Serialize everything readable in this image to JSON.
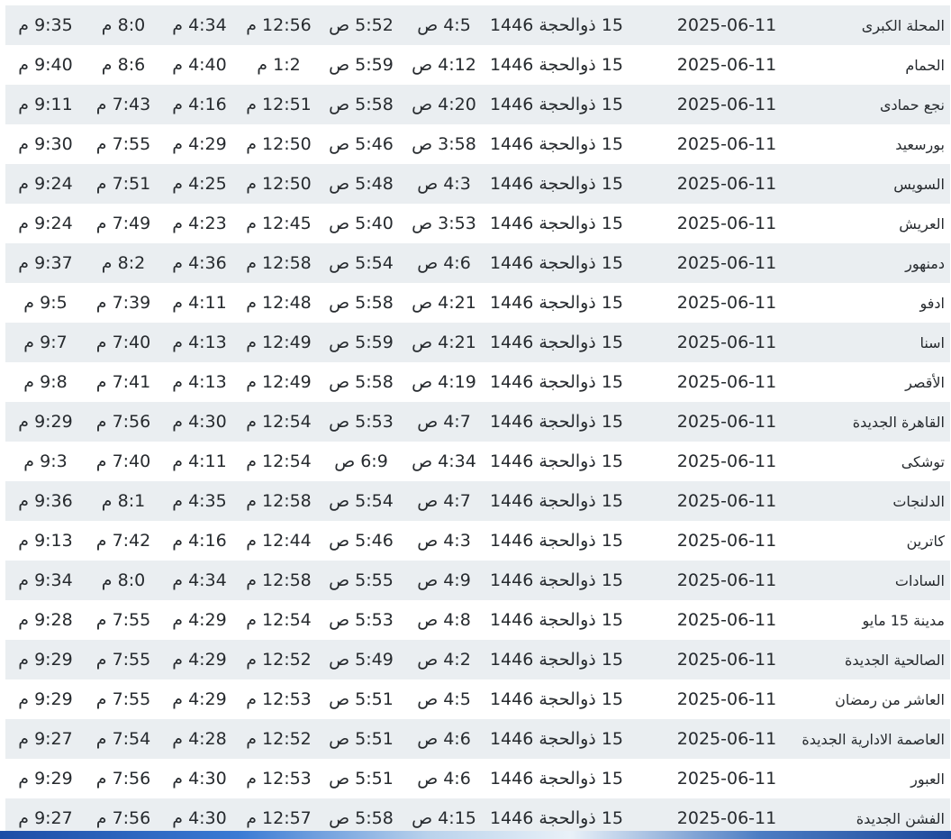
{
  "prayer_table": {
    "rows": [
      {
        "city": "المحلة الكبرى",
        "gregorian": "2025-06-11",
        "hijri": "15 ذوالحجة 1446",
        "fajr": "4:5 ص",
        "sunrise": "5:52 ص",
        "dhuhr": "12:56 م",
        "asr": "4:34 م",
        "maghrib": "8:0 م",
        "isha": "9:35 م"
      },
      {
        "city": "الحمام",
        "gregorian": "2025-06-11",
        "hijri": "15 ذوالحجة 1446",
        "fajr": "4:12 ص",
        "sunrise": "5:59 ص",
        "dhuhr": "1:2 م",
        "asr": "4:40 م",
        "maghrib": "8:6 م",
        "isha": "9:40 م"
      },
      {
        "city": "نجع حمادى",
        "gregorian": "2025-06-11",
        "hijri": "15 ذوالحجة 1446",
        "fajr": "4:20 ص",
        "sunrise": "5:58 ص",
        "dhuhr": "12:51 م",
        "asr": "4:16 م",
        "maghrib": "7:43 م",
        "isha": "9:11 م"
      },
      {
        "city": "بورسعيد",
        "gregorian": "2025-06-11",
        "hijri": "15 ذوالحجة 1446",
        "fajr": "3:58 ص",
        "sunrise": "5:46 ص",
        "dhuhr": "12:50 م",
        "asr": "4:29 م",
        "maghrib": "7:55 م",
        "isha": "9:30 م"
      },
      {
        "city": "السويس",
        "gregorian": "2025-06-11",
        "hijri": "15 ذوالحجة 1446",
        "fajr": "4:3 ص",
        "sunrise": "5:48 ص",
        "dhuhr": "12:50 م",
        "asr": "4:25 م",
        "maghrib": "7:51 م",
        "isha": "9:24 م"
      },
      {
        "city": "العريش",
        "gregorian": "2025-06-11",
        "hijri": "15 ذوالحجة 1446",
        "fajr": "3:53 ص",
        "sunrise": "5:40 ص",
        "dhuhr": "12:45 م",
        "asr": "4:23 م",
        "maghrib": "7:49 م",
        "isha": "9:24 م"
      },
      {
        "city": "دمنهور",
        "gregorian": "2025-06-11",
        "hijri": "15 ذوالحجة 1446",
        "fajr": "4:6 ص",
        "sunrise": "5:54 ص",
        "dhuhr": "12:58 م",
        "asr": "4:36 م",
        "maghrib": "8:2 م",
        "isha": "9:37 م"
      },
      {
        "city": "ادفو",
        "gregorian": "2025-06-11",
        "hijri": "15 ذوالحجة 1446",
        "fajr": "4:21 ص",
        "sunrise": "5:58 ص",
        "dhuhr": "12:48 م",
        "asr": "4:11 م",
        "maghrib": "7:39 م",
        "isha": "9:5 م"
      },
      {
        "city": "اسنا",
        "gregorian": "2025-06-11",
        "hijri": "15 ذوالحجة 1446",
        "fajr": "4:21 ص",
        "sunrise": "5:59 ص",
        "dhuhr": "12:49 م",
        "asr": "4:13 م",
        "maghrib": "7:40 م",
        "isha": "9:7 م"
      },
      {
        "city": "الأقصر",
        "gregorian": "2025-06-11",
        "hijri": "15 ذوالحجة 1446",
        "fajr": "4:19 ص",
        "sunrise": "5:58 ص",
        "dhuhr": "12:49 م",
        "asr": "4:13 م",
        "maghrib": "7:41 م",
        "isha": "9:8 م"
      },
      {
        "city": "القاهرة الجديدة",
        "gregorian": "2025-06-11",
        "hijri": "15 ذوالحجة 1446",
        "fajr": "4:7 ص",
        "sunrise": "5:53 ص",
        "dhuhr": "12:54 م",
        "asr": "4:30 م",
        "maghrib": "7:56 م",
        "isha": "9:29 م"
      },
      {
        "city": "توشكى",
        "gregorian": "2025-06-11",
        "hijri": "15 ذوالحجة 1446",
        "fajr": "4:34 ص",
        "sunrise": "6:9 ص",
        "dhuhr": "12:54 م",
        "asr": "4:11 م",
        "maghrib": "7:40 م",
        "isha": "9:3 م"
      },
      {
        "city": "الدلنجات",
        "gregorian": "2025-06-11",
        "hijri": "15 ذوالحجة 1446",
        "fajr": "4:7 ص",
        "sunrise": "5:54 ص",
        "dhuhr": "12:58 م",
        "asr": "4:35 م",
        "maghrib": "8:1 م",
        "isha": "9:36 م"
      },
      {
        "city": "كاترين",
        "gregorian": "2025-06-11",
        "hijri": "15 ذوالحجة 1446",
        "fajr": "4:3 ص",
        "sunrise": "5:46 ص",
        "dhuhr": "12:44 م",
        "asr": "4:16 م",
        "maghrib": "7:42 م",
        "isha": "9:13 م"
      },
      {
        "city": "السادات",
        "gregorian": "2025-06-11",
        "hijri": "15 ذوالحجة 1446",
        "fajr": "4:9 ص",
        "sunrise": "5:55 ص",
        "dhuhr": "12:58 م",
        "asr": "4:34 م",
        "maghrib": "8:0 م",
        "isha": "9:34 م"
      },
      {
        "city": "مدينة 15 مايو",
        "gregorian": "2025-06-11",
        "hijri": "15 ذوالحجة 1446",
        "fajr": "4:8 ص",
        "sunrise": "5:53 ص",
        "dhuhr": "12:54 م",
        "asr": "4:29 م",
        "maghrib": "7:55 م",
        "isha": "9:28 م"
      },
      {
        "city": "الصالحية الجديدة",
        "gregorian": "2025-06-11",
        "hijri": "15 ذوالحجة 1446",
        "fajr": "4:2 ص",
        "sunrise": "5:49 ص",
        "dhuhr": "12:52 م",
        "asr": "4:29 م",
        "maghrib": "7:55 م",
        "isha": "9:29 م"
      },
      {
        "city": "العاشر من رمضان",
        "gregorian": "2025-06-11",
        "hijri": "15 ذوالحجة 1446",
        "fajr": "4:5 ص",
        "sunrise": "5:51 ص",
        "dhuhr": "12:53 م",
        "asr": "4:29 م",
        "maghrib": "7:55 م",
        "isha": "9:29 م"
      },
      {
        "city": "العاصمة الادارية الجديدة",
        "gregorian": "2025-06-11",
        "hijri": "15 ذوالحجة 1446",
        "fajr": "4:6 ص",
        "sunrise": "5:51 ص",
        "dhuhr": "12:52 م",
        "asr": "4:28 م",
        "maghrib": "7:54 م",
        "isha": "9:27 م"
      },
      {
        "city": "العبور",
        "gregorian": "2025-06-11",
        "hijri": "15 ذوالحجة 1446",
        "fajr": "4:6 ص",
        "sunrise": "5:51 ص",
        "dhuhr": "12:53 م",
        "asr": "4:30 م",
        "maghrib": "7:56 م",
        "isha": "9:29 م"
      },
      {
        "city": "الفشن الجديدة",
        "gregorian": "2025-06-11",
        "hijri": "15 ذوالحجة 1446",
        "fajr": "4:15 ص",
        "sunrise": "5:58 ص",
        "dhuhr": "12:57 م",
        "asr": "4:30 م",
        "maghrib": "7:56 م",
        "isha": "9:27 م"
      }
    ]
  },
  "colors": {
    "stripe": "#eaeef1",
    "text": "#262a2e"
  }
}
